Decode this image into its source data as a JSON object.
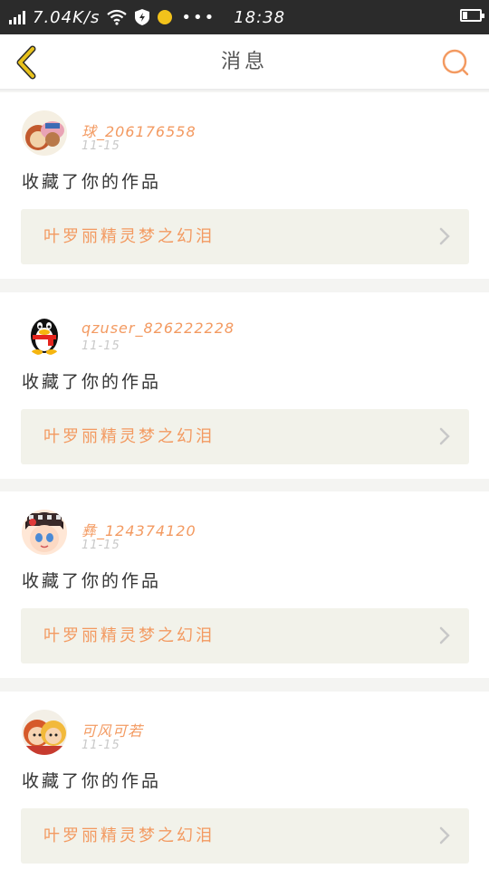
{
  "status_bar": {
    "speed": "7.04K/s",
    "time": "18:38"
  },
  "header": {
    "title": "消息"
  },
  "messages": [
    {
      "username": "球_206176558",
      "date": "11-15",
      "action": "收藏了你的作品",
      "work_title": "叶罗丽精灵梦之幻泪"
    },
    {
      "username": "qzuser_826222228",
      "date": "11-15",
      "action": "收藏了你的作品",
      "work_title": "叶罗丽精灵梦之幻泪"
    },
    {
      "username": "彝_124374120",
      "date": "11-15",
      "action": "收藏了你的作品",
      "work_title": "叶罗丽精灵梦之幻泪"
    },
    {
      "username": "可风可若",
      "date": "11-15",
      "action": "收藏了你的作品",
      "work_title": "叶罗丽精灵梦之幻泪"
    }
  ],
  "colors": {
    "accent": "#f39a61",
    "back_arrow": "#e8c21c",
    "status_bar": "#2b2b2b",
    "card_bg": "#f2f2ea"
  }
}
